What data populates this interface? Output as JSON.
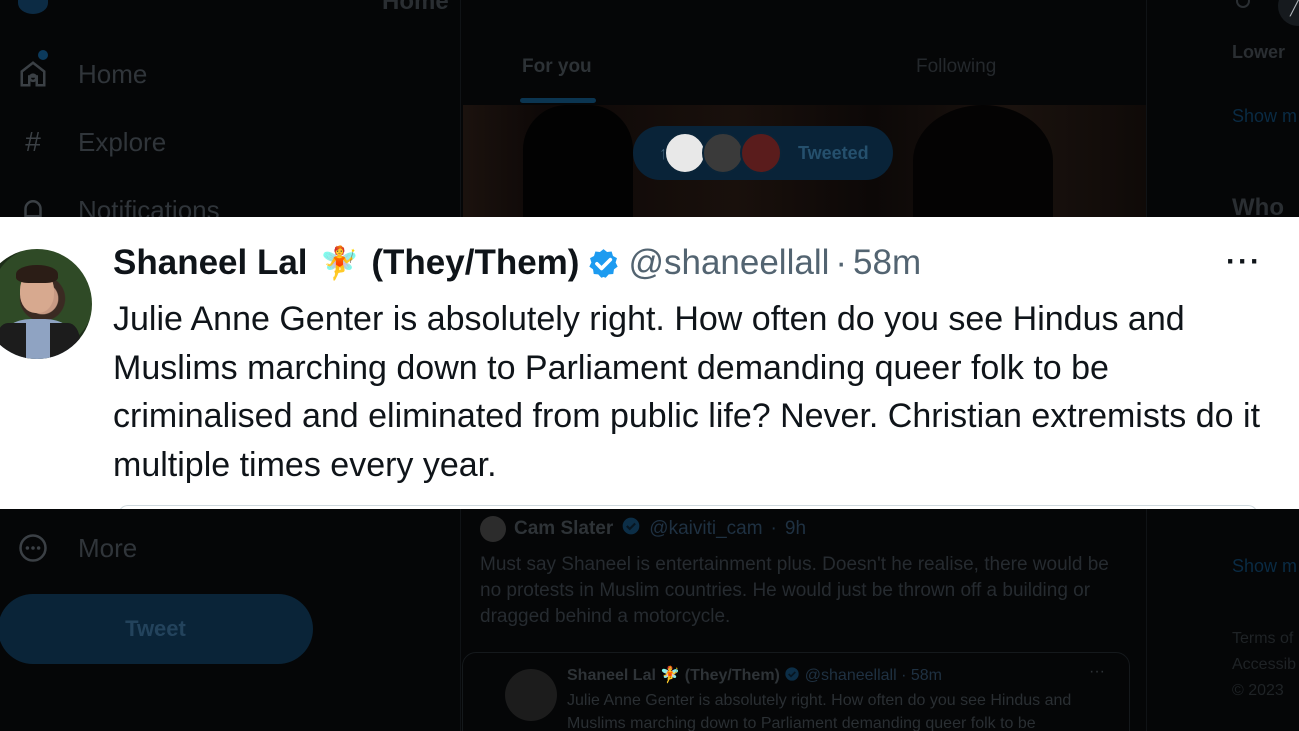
{
  "header": {
    "title": "Home"
  },
  "sidebar": {
    "items": [
      {
        "label": "Home",
        "icon": "home-icon"
      },
      {
        "label": "Explore",
        "icon": "hashtag-icon"
      },
      {
        "label": "Notifications",
        "icon": "bell-icon"
      }
    ],
    "more_label": "More",
    "tweet_button": "Tweet"
  },
  "tabs": [
    {
      "label": "For you",
      "active": true
    },
    {
      "label": "Following",
      "active": false
    }
  ],
  "new_tweets_pill": {
    "label": "Tweeted",
    "icon": "arrow-up-icon"
  },
  "right_sidebar": {
    "lower_label": "Lower",
    "show_more_1": "Show m",
    "who_label": "Who",
    "show_more_2": "Show m",
    "footer": [
      "Terms of",
      "Accessib",
      "© 2023"
    ]
  },
  "highlighted_tweet": {
    "name": "Shaneel Lal",
    "emoji": "🧚",
    "pronouns": "(They/Them)",
    "handle": "@shaneellall",
    "separator": "·",
    "time": "58m",
    "more": "···",
    "text": "Julie Anne Genter is absolutely right. How often do you see Hindus and Muslims marching down to Parliament demanding queer folk to be criminalised and eliminated from public life? Never. Christian extremists do it multiple times every year."
  },
  "reply_tweet": {
    "name": "Cam Slater",
    "handle": "@kaiviti_cam",
    "separator": "·",
    "time": "9h",
    "text": "Must say Shaneel is entertainment plus. Doesn't he realise, there would be no protests in Muslim countries. He would just be thrown off a building or dragged behind a motorcycle."
  },
  "quoted_tweet": {
    "name": "Shaneel Lal",
    "emoji": "🧚",
    "pronouns": "(They/Them)",
    "handle": "@shaneellall",
    "separator": "·",
    "time": "58m",
    "more": "···",
    "text": "Julie Anne Genter is absolutely right. How often do you see Hindus and Muslims marching down to Parliament demanding queer folk to be"
  },
  "colors": {
    "accent": "#1d9bf0",
    "verified": "#1d9bf0",
    "text_primary": "#0f1419",
    "text_secondary": "#536471"
  }
}
